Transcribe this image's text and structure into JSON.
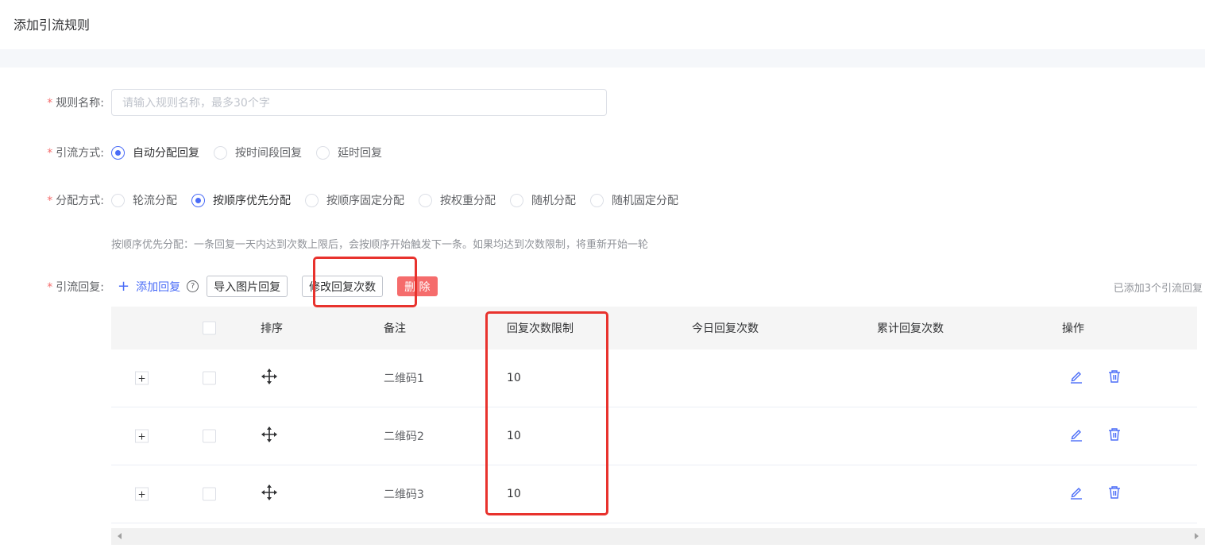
{
  "header": {
    "title": "添加引流规则"
  },
  "form": {
    "name": {
      "label": "规则名称:",
      "placeholder": "请输入规则名称，最多30个字"
    },
    "method": {
      "label": "引流方式:",
      "options": [
        "自动分配回复",
        "按时间段回复",
        "延时回复"
      ],
      "selected": 0
    },
    "allocation": {
      "label": "分配方式:",
      "options": [
        "轮流分配",
        "按顺序优先分配",
        "按顺序固定分配",
        "按权重分配",
        "随机分配",
        "随机固定分配"
      ],
      "selected": 1,
      "hint": "按顺序优先分配：一条回复一天内达到次数上限后，会按顺序开始触发下一条。如果均达到次数限制，将重新开始一轮"
    },
    "replies": {
      "label": "引流回复:",
      "add_label": "添加回复",
      "help": "?",
      "import_button": "导入图片回复",
      "modify_button": "修改回复次数",
      "delete_button": "删 除",
      "count_text": "已添加3个引流回复"
    }
  },
  "table": {
    "headers": {
      "sort": "排序",
      "note": "备注",
      "limit": "回复次数限制",
      "today": "今日回复次数",
      "total": "累计回复次数",
      "ops": "操作"
    },
    "rows": [
      {
        "expand": "+",
        "note": "二维码1",
        "limit": "10",
        "today": "",
        "total": ""
      },
      {
        "expand": "+",
        "note": "二维码2",
        "limit": "10",
        "today": "",
        "total": ""
      },
      {
        "expand": "+",
        "note": "二维码3",
        "limit": "10",
        "today": "",
        "total": ""
      }
    ]
  },
  "colors": {
    "accent": "#4a6cf7",
    "danger": "#f56c6c",
    "highlight": "#e8322d"
  }
}
